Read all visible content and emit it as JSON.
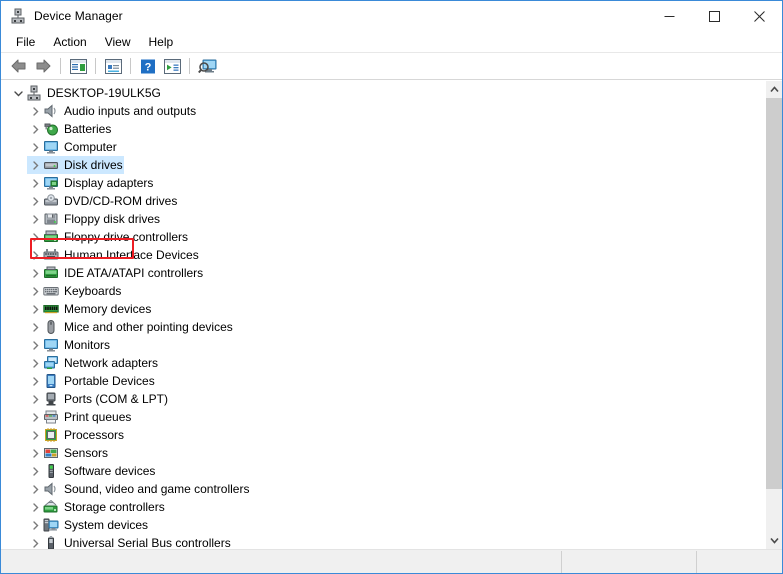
{
  "window": {
    "title": "Device Manager",
    "title_icon": "device-manager-icon",
    "controls": {
      "minimize": "minimize-icon",
      "maximize": "maximize-icon",
      "close": "close-icon"
    }
  },
  "menubar": {
    "items": [
      {
        "label": "File"
      },
      {
        "label": "Action"
      },
      {
        "label": "View"
      },
      {
        "label": "Help"
      }
    ]
  },
  "toolbar": {
    "buttons": [
      {
        "name": "back-icon",
        "tip": "Back"
      },
      {
        "name": "forward-icon",
        "tip": "Forward"
      },
      {
        "name": "show-hide-tree-icon",
        "tip": "Show/Hide console tree"
      },
      {
        "name": "properties-icon",
        "tip": "Properties"
      },
      {
        "name": "help-icon",
        "tip": "Help"
      },
      {
        "name": "update-driver-icon",
        "tip": "Update driver"
      },
      {
        "name": "scan-hardware-icon",
        "tip": "Scan for hardware changes"
      }
    ]
  },
  "tree": {
    "root": {
      "label": "DESKTOP-19ULK5G",
      "icon": "computer-root-icon",
      "expanded": true
    },
    "nodes": [
      {
        "label": "Audio inputs and outputs",
        "icon": "speaker-icon",
        "selected": false
      },
      {
        "label": "Batteries",
        "icon": "battery-icon",
        "selected": false
      },
      {
        "label": "Computer",
        "icon": "monitor-icon",
        "selected": false
      },
      {
        "label": "Disk drives",
        "icon": "disk-drive-icon",
        "selected": true
      },
      {
        "label": "Display adapters",
        "icon": "display-adapter-icon",
        "selected": false
      },
      {
        "label": "DVD/CD-ROM drives",
        "icon": "dvd-drive-icon",
        "selected": false
      },
      {
        "label": "Floppy disk drives",
        "icon": "floppy-disk-icon",
        "selected": false
      },
      {
        "label": "Floppy drive controllers",
        "icon": "floppy-ctrl-icon",
        "selected": false
      },
      {
        "label": "Human Interface Devices",
        "icon": "hid-icon",
        "selected": false
      },
      {
        "label": "IDE ATA/ATAPI controllers",
        "icon": "ide-controller-icon",
        "selected": false
      },
      {
        "label": "Keyboards",
        "icon": "keyboard-icon",
        "selected": false
      },
      {
        "label": "Memory devices",
        "icon": "memory-icon",
        "selected": false
      },
      {
        "label": "Mice and other pointing devices",
        "icon": "mouse-icon",
        "selected": false
      },
      {
        "label": "Monitors",
        "icon": "monitor-icon",
        "selected": false
      },
      {
        "label": "Network adapters",
        "icon": "network-adapter-icon",
        "selected": false
      },
      {
        "label": "Portable Devices",
        "icon": "portable-device-icon",
        "selected": false
      },
      {
        "label": "Ports (COM & LPT)",
        "icon": "port-icon",
        "selected": false
      },
      {
        "label": "Print queues",
        "icon": "printer-icon",
        "selected": false
      },
      {
        "label": "Processors",
        "icon": "processor-icon",
        "selected": false
      },
      {
        "label": "Sensors",
        "icon": "sensor-icon",
        "selected": false
      },
      {
        "label": "Software devices",
        "icon": "software-device-icon",
        "selected": false
      },
      {
        "label": "Sound, video and game controllers",
        "icon": "speaker-icon",
        "selected": false
      },
      {
        "label": "Storage controllers",
        "icon": "storage-ctrl-icon",
        "selected": false
      },
      {
        "label": "System devices",
        "icon": "system-device-icon",
        "selected": false
      },
      {
        "label": "Universal Serial Bus controllers",
        "icon": "usb-icon",
        "selected": false
      }
    ]
  },
  "annotation": {
    "target": "Disk drives",
    "color": "#ee1d23"
  },
  "statusbar": {
    "panes": [
      "",
      "",
      ""
    ]
  },
  "colors": {
    "window_border": "#3a8ad8",
    "selection": "#cce8ff",
    "annotation": "#ee1d23",
    "statusbar_bg": "#f0f0f0",
    "scroll_thumb": "#cdcdcd"
  },
  "scrollbar": {
    "up_arrow": "chevron-up-icon",
    "down_arrow": "chevron-down-icon"
  }
}
